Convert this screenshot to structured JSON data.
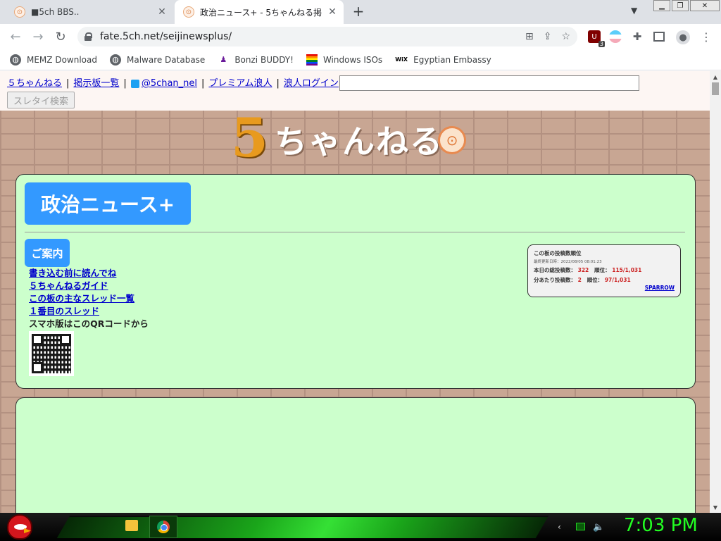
{
  "browser": {
    "tabs": [
      {
        "title": "■5ch BBS..",
        "favicon": "5ch-seal-icon",
        "active": false
      },
      {
        "title": "政治ニュース+ - 5ちゃんねる掲",
        "favicon": "5ch-seal-icon",
        "active": true
      }
    ],
    "new_tab": "+",
    "url": "fate.5ch.net/seijinewsplus/",
    "extension_badge": "3",
    "bookmarks": [
      {
        "label": "MEMZ Download",
        "icon": "globe-icon"
      },
      {
        "label": "Malware Database",
        "icon": "globe-icon"
      },
      {
        "label": "Bonzi BUDDY!",
        "icon": "bonzi-icon"
      },
      {
        "label": "Windows ISOs",
        "icon": "rainbow-flag-icon"
      },
      {
        "label": "Egyptian Embassy",
        "icon": "wix-icon"
      }
    ]
  },
  "page": {
    "topnav": {
      "links": [
        "５ちゃんねる",
        "掲示板一覧",
        "@5chan_nel",
        "プレミアム浪人",
        "浪人ログイン"
      ],
      "search_button": "スレタイ検索"
    },
    "logo": {
      "text": "ちゃんねる",
      "digit": "5"
    },
    "board_title": "政治ニュース+",
    "guide": {
      "header": "ご案内",
      "links": [
        "書き込む前に読んでね",
        "５ちゃんねるガイド",
        "この板の主なスレッド一覧",
        "１番目のスレッド"
      ],
      "qr_text": "スマホ版はこのQRコードから"
    },
    "ranking": {
      "title": "この板の投稿数順位",
      "updated": "最終更新日時：2022/08/05 08:01:23",
      "daily_label": "本日の総投稿数：",
      "daily_count": "322",
      "daily_rank_label": "順位：",
      "daily_rank": "115/1,031",
      "per_min_label": "分あたり投稿数：",
      "per_min_count": "2",
      "per_min_rank_label": "順位：",
      "per_min_rank": "97/1,031",
      "credit": "SPARROW"
    }
  },
  "taskbar": {
    "clock": "7:03 PM",
    "accent_color": "#22ff22"
  }
}
